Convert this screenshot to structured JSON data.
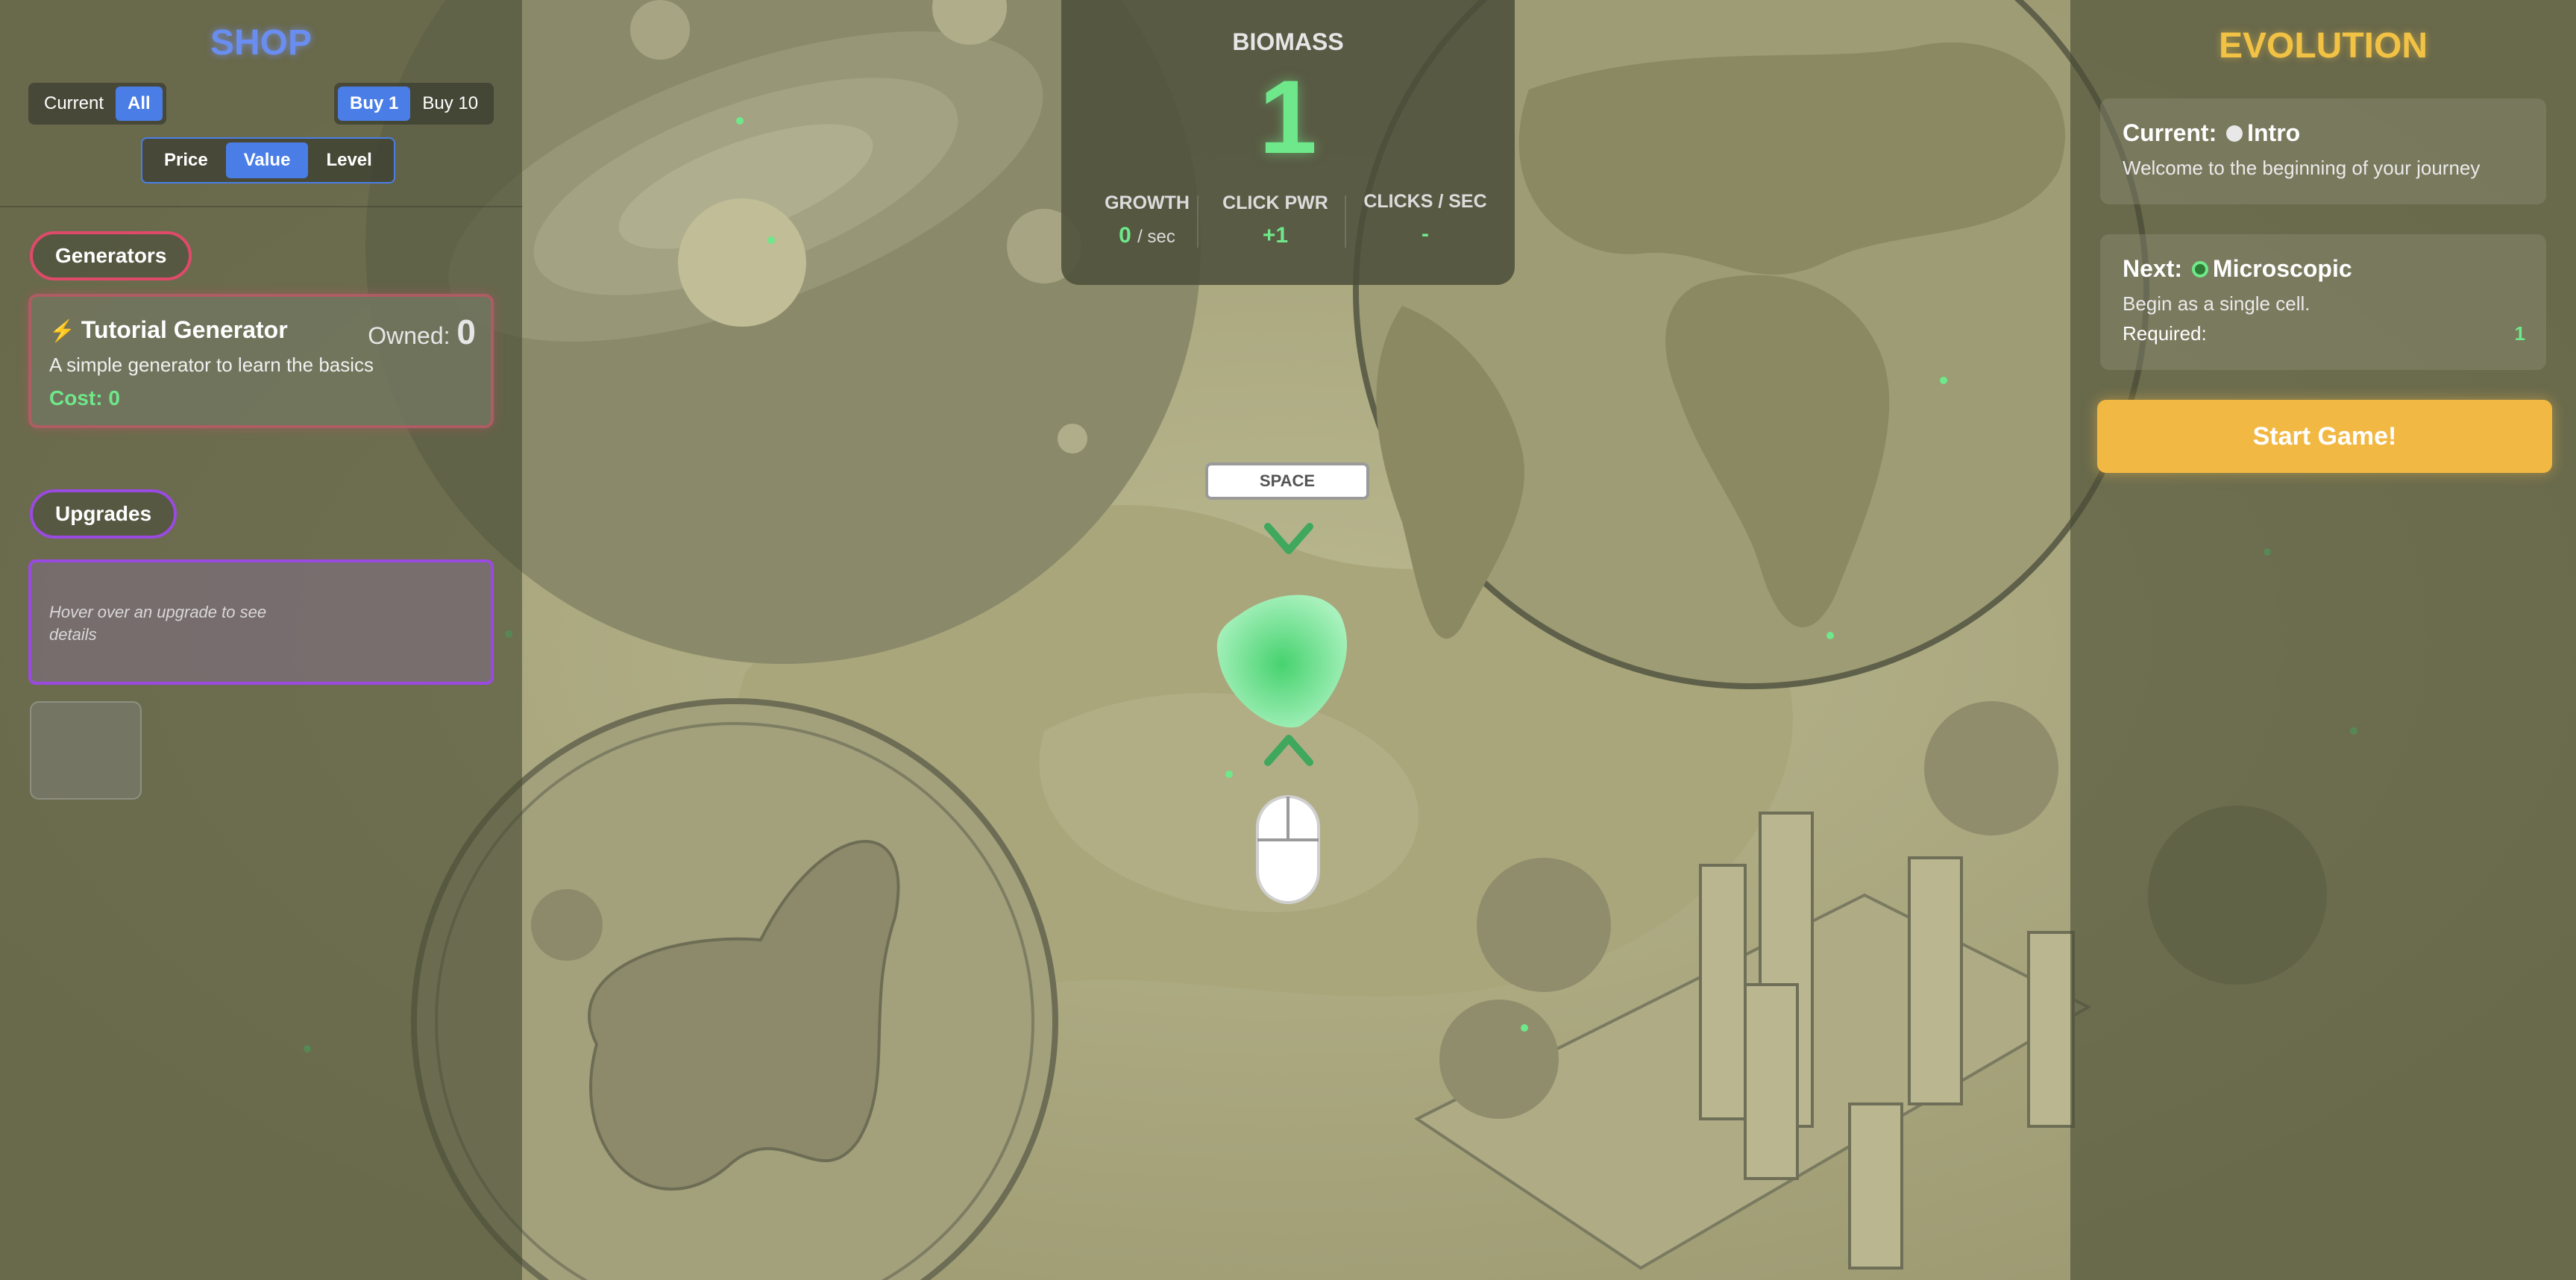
{
  "shop": {
    "title": "SHOP",
    "show_filter": {
      "current": "Current",
      "all": "All",
      "selected": "All"
    },
    "buy_amount": {
      "buy1": "Buy 1",
      "buy10": "Buy 10",
      "selected": "Buy 1"
    },
    "sort": {
      "price": "Price",
      "value": "Value",
      "level": "Level",
      "selected": "Value"
    },
    "generators": {
      "label": "Generators",
      "items": [
        {
          "icon": "lightning-icon",
          "name": "Tutorial Generator",
          "owned_label": "Owned:",
          "owned": "0",
          "description": "A simple generator to learn the basics",
          "cost_label": "Cost:",
          "cost": "0"
        }
      ]
    },
    "upgrades": {
      "label": "Upgrades",
      "hint": "Hover over an upgrade to see details"
    }
  },
  "stats": {
    "biomass_label": "BIOMASS",
    "biomass": "1",
    "growth_label": "GROWTH",
    "growth_value": "0",
    "growth_unit": "/ sec",
    "click_power_label": "CLICK PWR",
    "click_power": "+1",
    "clicks_label": "CLICKS / SEC",
    "clicks_value": "-"
  },
  "controls": {
    "space_key": "SPACE",
    "icons": [
      "chevron-down-icon",
      "organism-blob",
      "chevron-up-icon",
      "mouse-icon"
    ]
  },
  "evolution": {
    "title": "EVOLUTION",
    "current": {
      "label": "Current:",
      "name": "Intro",
      "description": "Welcome to the beginning of your journey",
      "dot_color": "#e8e8e8"
    },
    "next": {
      "label": "Next:",
      "name": "Microscopic",
      "description": "Begin as a single cell.",
      "required_label": "Required:",
      "required": "1",
      "dot_color": "#3a8a3a"
    },
    "start_button": "Start Game!"
  },
  "colors": {
    "accent_blue": "#4a7ee6",
    "biomass_green": "#6ee88a",
    "evolution_gold": "#f2c244",
    "generators_red": "#e04a6a",
    "upgrades_purple": "#9a4ae0"
  }
}
